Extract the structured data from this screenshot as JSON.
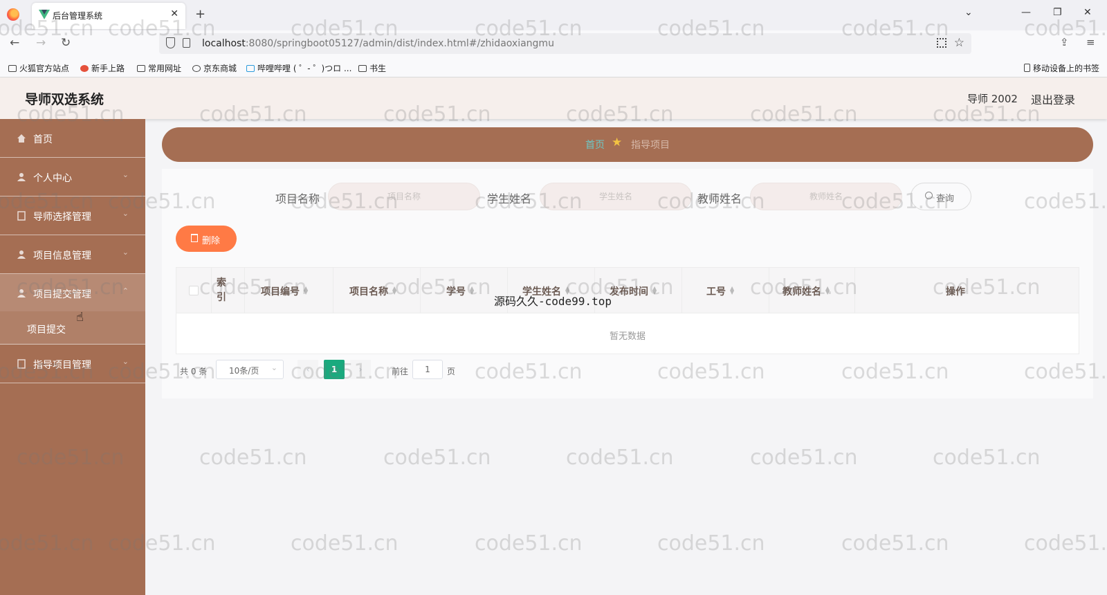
{
  "browser": {
    "tab_title": "后台管理系统",
    "url_host": "localhost",
    "url_rest": ":8080/springboot05127/admin/dist/index.html#/zhidaoxiangmu",
    "bookmarks": [
      "火狐官方站点",
      "新手上路",
      "常用网址",
      "京东商城",
      "哔哩哔哩 ( ゜- ゜)つロ ...",
      "书生"
    ],
    "mobile_bookmarks": "移动设备上的书签"
  },
  "header": {
    "title": "导师双选系统",
    "user": "导师 2002",
    "logout": "退出登录"
  },
  "sidebar": {
    "items": [
      {
        "label": "首页"
      },
      {
        "label": "个人中心"
      },
      {
        "label": "导师选择管理"
      },
      {
        "label": "项目信息管理"
      },
      {
        "label": "项目提交管理"
      },
      {
        "label": "指导项目管理"
      }
    ],
    "sub_item": "项目提交"
  },
  "breadcrumb": {
    "home": "首页",
    "current": "指导项目"
  },
  "search": {
    "project_label": "项目名称",
    "project_placeholder": "项目名称",
    "student_label": "学生姓名",
    "student_placeholder": "学生姓名",
    "teacher_label": "教师姓名",
    "teacher_placeholder": "教师姓名",
    "button": "查询"
  },
  "actions": {
    "delete": "删除"
  },
  "table": {
    "index_header": "索引",
    "columns": [
      "项目编号",
      "项目名称",
      "学号",
      "学生姓名",
      "发布时间",
      "工号",
      "教师姓名"
    ],
    "action_header": "操作",
    "empty_text": "暂无数据"
  },
  "pagination": {
    "total": "共 0 条",
    "page_size": "10条/页",
    "current_page": "1",
    "goto_label": "前往",
    "goto_value": "1",
    "page_unit": "页"
  },
  "overlay_text": "源码久久-code99.top",
  "watermark": "code51.cn"
}
